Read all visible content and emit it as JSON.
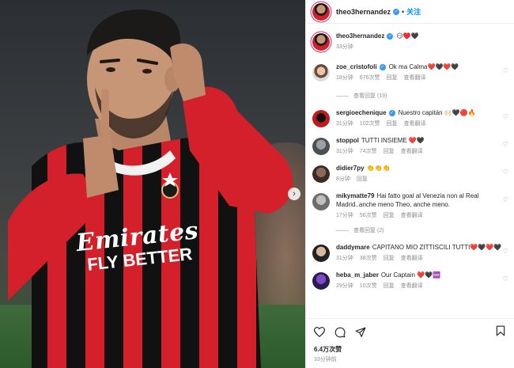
{
  "post": {
    "username": "theo3hernandez",
    "follow_label": "关注",
    "dot": "•",
    "caption": {
      "username": "theo3hernandez",
      "text": "😏♥️🖤",
      "time": "33分钟"
    },
    "jersey": {
      "sponsor_line1": "Emirates",
      "sponsor_line2": "FLY BETTER"
    },
    "likes": "6.4万次赞",
    "time": "33分钟前"
  },
  "comments": [
    {
      "username": "zoe_cristofoli",
      "verified": true,
      "text": "Ok ma Calma❤️🖤❤️🖤",
      "time": "18分钟",
      "likes": "676次赞",
      "reply": "回复",
      "translate": "查看翻译",
      "replies": "查看回复 (19)"
    },
    {
      "username": "sergioechenique",
      "verified": true,
      "text": "Nuestro capitán 🙌🏻🖤🔴🔥",
      "time": "31分钟",
      "likes": "102次赞",
      "reply": "回复",
      "translate": "查看翻译"
    },
    {
      "username": "stoppol",
      "verified": false,
      "text": "TUTTI INSIEME ❤️🖤",
      "time": "31分钟",
      "likes": "74次赞",
      "reply": "回复",
      "translate": "查看翻译"
    },
    {
      "username": "didier7py",
      "verified": false,
      "text": "👏👏👏",
      "time": "8分钟",
      "reply": "回复"
    },
    {
      "username": "mikymatte79",
      "verified": false,
      "text": "Hai fatto goal al Venezia non al Real Madrid..anche meno Theo, anche meno.",
      "time": "17分钟",
      "likes": "56次赞",
      "reply": "回复",
      "translate": "查看翻译",
      "replies": "查看回复 (2)"
    },
    {
      "username": "daddymare",
      "verified": false,
      "text": "CAPITANO MIO ZITTISCILI TUTTI❤️🖤❤️🖤",
      "time": "31分钟",
      "likes": "38次赞",
      "reply": "回复",
      "translate": "查看翻译"
    },
    {
      "username": "heba_m_jaber",
      "verified": false,
      "text": "Our Captain ❤️🖤♾️",
      "time": "29分钟",
      "likes": "10次赞",
      "reply": "回复",
      "translate": "查看翻译"
    }
  ],
  "colors": {
    "accent": "#0095f6",
    "verified": "#3897f0",
    "milan_red": "#d4202a",
    "milan_black": "#111111",
    "muted": "#8e8e8e"
  },
  "icons": [
    "heart-icon",
    "comment-icon",
    "share-icon",
    "bookmark-icon",
    "chevron-right-icon",
    "verified-icon"
  ]
}
